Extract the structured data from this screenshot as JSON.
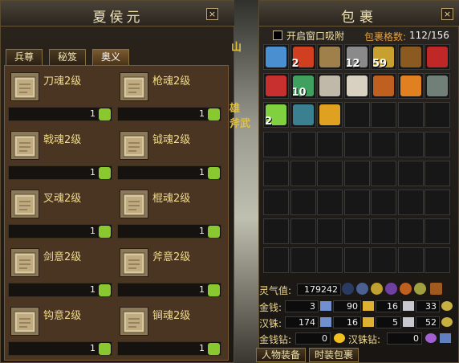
{
  "left_panel": {
    "title": "夏侯元",
    "close": "×",
    "tabs": [
      {
        "label": "兵尊",
        "active": false
      },
      {
        "label": "秘笈",
        "active": false
      },
      {
        "label": "奥义",
        "active": true
      }
    ],
    "skills": [
      {
        "name": "刀魂2级",
        "count": "1"
      },
      {
        "name": "枪魂2级",
        "count": "1"
      },
      {
        "name": "戟魂2级",
        "count": "1"
      },
      {
        "name": "钺魂2级",
        "count": "1"
      },
      {
        "name": "叉魂2级",
        "count": "1"
      },
      {
        "name": "棍魂2级",
        "count": "1"
      },
      {
        "name": "剑意2级",
        "count": "1"
      },
      {
        "name": "斧意2级",
        "count": "1"
      },
      {
        "name": "钩意2级",
        "count": "1"
      },
      {
        "name": "锏魂2级",
        "count": "1"
      }
    ]
  },
  "scene": {
    "text1": "山",
    "text2": "雄",
    "text3": "斧武"
  },
  "right_panel": {
    "title": "包裹",
    "close": "×",
    "auto_absorb_label": "开启窗口吸附",
    "capacity_label": "包裹格数:",
    "capacity_value": "112/156",
    "items": [
      {
        "color": "#4a90d0",
        "count": ""
      },
      {
        "color": "#d04020",
        "count": "2"
      },
      {
        "color": "#a0804a",
        "count": ""
      },
      {
        "color": "#8a8a8a",
        "count": "12"
      },
      {
        "color": "#c8a030",
        "count": "59"
      },
      {
        "color": "#8a5a20",
        "count": ""
      },
      {
        "color": "#c02828",
        "count": ""
      },
      {
        "color": "#c83030",
        "count": ""
      },
      {
        "color": "#40a060",
        "count": "10"
      },
      {
        "color": "#c0b8a8",
        "count": ""
      },
      {
        "color": "#d8d0c0",
        "count": ""
      },
      {
        "color": "#c06020",
        "count": ""
      },
      {
        "color": "#e08020",
        "count": ""
      },
      {
        "color": "#708078",
        "count": ""
      },
      {
        "color": "#80d040",
        "count": "2"
      },
      {
        "color": "#3a8090",
        "count": ""
      },
      {
        "color": "#e0a020",
        "count": ""
      }
    ],
    "lingqi_label": "灵气值:",
    "lingqi_value": "179242",
    "money_label": "金钱:",
    "money_values": [
      "3",
      "90",
      "16",
      "33"
    ],
    "hanzhu_label": "汉铢:",
    "hanzhu_values": [
      "174",
      "16",
      "5",
      "52"
    ],
    "jinqianzuan_label": "金钱钻:",
    "jinqianzuan_value": "0",
    "hanzhuzuan_label": "汉铢钻:",
    "hanzhuzuan_value": "0",
    "btn_equip": "人物装备",
    "btn_fashion": "时装包裹"
  }
}
